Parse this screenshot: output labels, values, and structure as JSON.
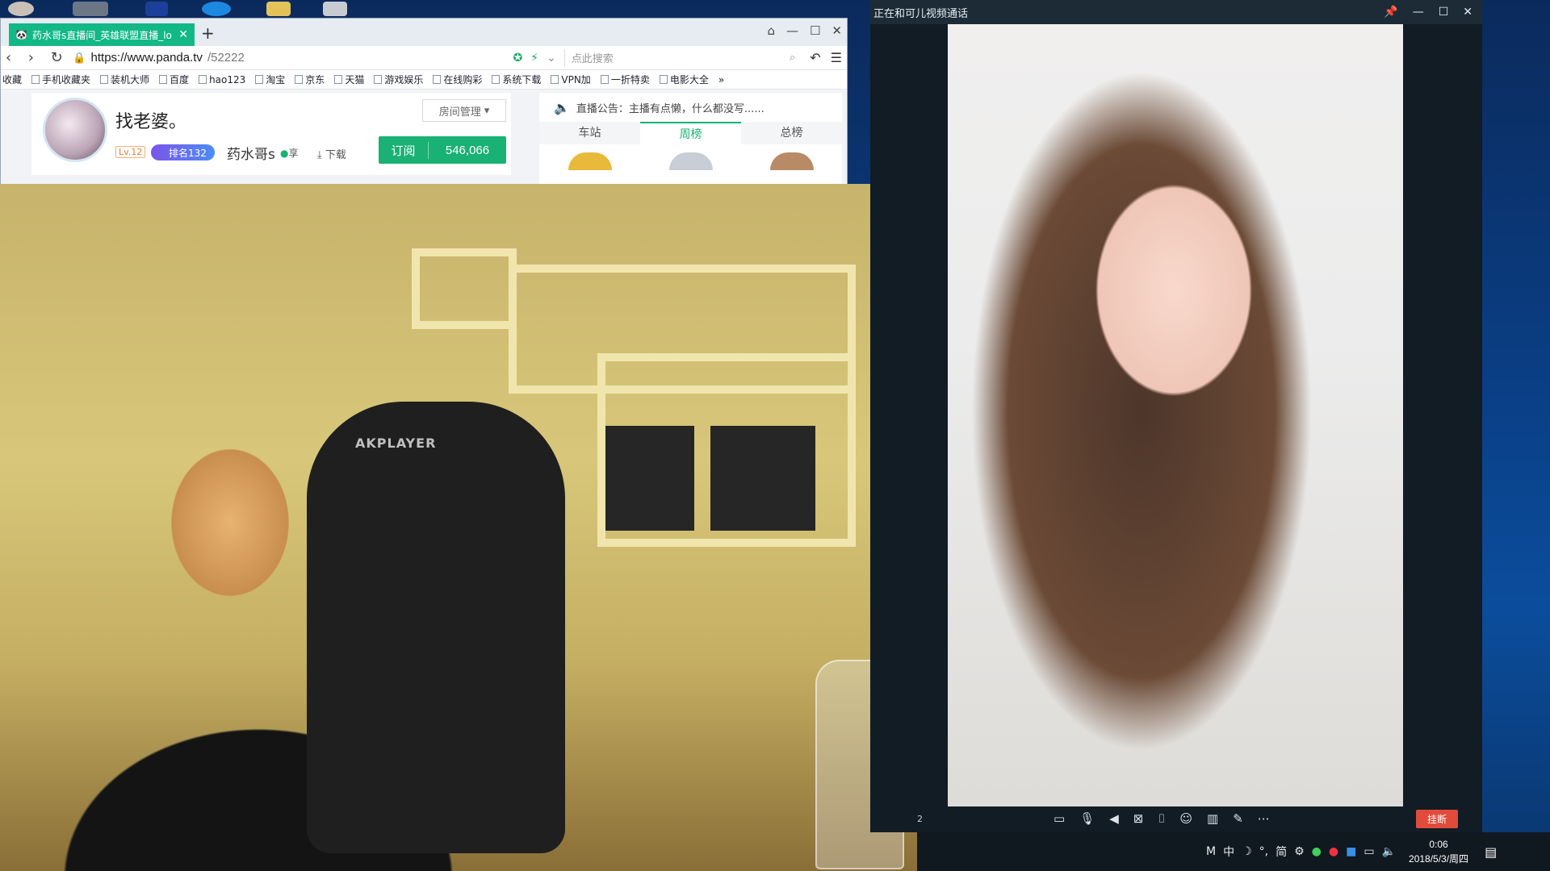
{
  "browser": {
    "tab_title": "药水哥s直播间_英雄联盟直播_lo",
    "tab_close": "✕",
    "new_tab": "+",
    "url_host": "https://www.panda.tv",
    "url_path": "/52222",
    "search_placeholder": "点此搜索",
    "bookmarks": [
      "收藏",
      "手机收藏夹",
      "装机大师",
      "百度",
      "hao123",
      "淘宝",
      "京东",
      "天猫",
      "游戏娱乐",
      "在线购彩",
      "系统下载",
      "VPN加",
      "一折特卖",
      "电影大全",
      "»"
    ]
  },
  "room": {
    "title": "找老婆。",
    "manage": "房间管理",
    "level": "Lv.12",
    "rank": "排名132",
    "host_name": "药水哥s",
    "share": "享",
    "download": "下载",
    "subscribe_label": "订阅",
    "subscribe_count": "546,066"
  },
  "leaderboard": {
    "announce": "直播公告：主播有点懒，什么都没写......",
    "tabs": [
      "车站",
      "周榜",
      "总榜"
    ]
  },
  "webcam": {
    "chair_logo": "AKPLAYER"
  },
  "call": {
    "title": "正在和可儿视频通话",
    "hangup": "挂断",
    "side_number": "2"
  },
  "taskbar": {
    "time": "0:06",
    "date": "2018/5/3/周四",
    "tray_text": [
      "M",
      "中",
      "☽",
      "°,",
      "简",
      "⚙"
    ]
  },
  "colors": {
    "accent": "#19b174",
    "tab": "#12b886",
    "hangup": "#e04b3c"
  }
}
